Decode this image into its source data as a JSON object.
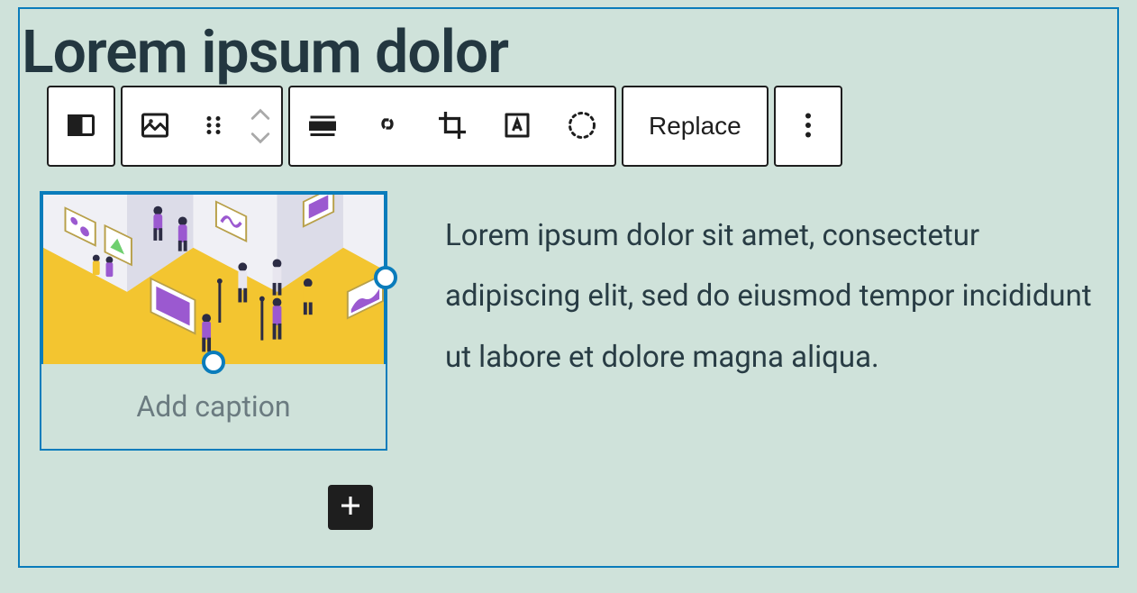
{
  "heading": "Lorem ipsum dolor",
  "toolbar": {
    "replace_label": "Replace"
  },
  "image_block": {
    "caption_placeholder": "Add caption"
  },
  "paragraph": "Lorem ipsum dolor sit amet, consectetur adipiscing elit, sed do eiusmod tempor incididunt ut labore et dolore magna aliqua."
}
